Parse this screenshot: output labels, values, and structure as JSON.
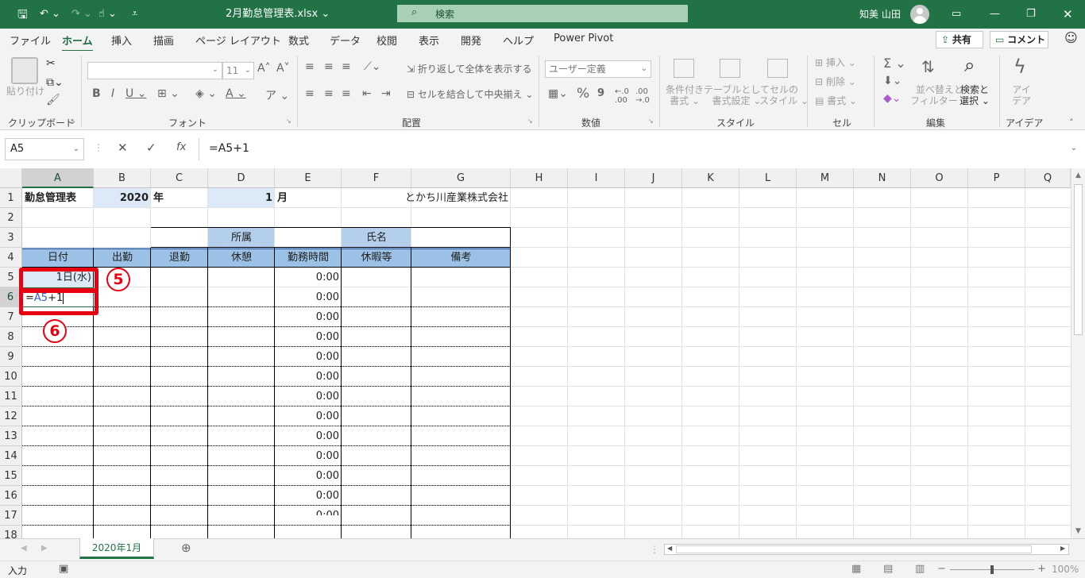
{
  "titlebar": {
    "autosave_icon": "save-icon",
    "filename": "2月勤怠管理表.xlsx",
    "search_placeholder": "検索",
    "user_name": "知美 山田",
    "bg_color": "#217346"
  },
  "menu": {
    "items": [
      "ファイル",
      "ホーム",
      "挿入",
      "描画",
      "ページ レイアウト",
      "数式",
      "データ",
      "校閲",
      "表示",
      "開発",
      "ヘルプ",
      "Power Pivot"
    ],
    "active": "ホーム",
    "share_label": "共有",
    "comment_label": "コメント"
  },
  "ribbon": {
    "paste_label": "貼り付け",
    "clipboard_group": "クリップボード",
    "font_group": "フォント",
    "font_size": "11",
    "align_group": "配置",
    "wrap_text": "折り返して全体を表示する",
    "merge_center": "セルを結合して中央揃え",
    "number_group": "数値",
    "number_format": "ユーザー定義",
    "styles_group": "スタイル",
    "cond_format_1": "条件付き",
    "cond_format_2": "書式",
    "format_table_1": "テーブルとして",
    "format_table_2": "書式設定",
    "cell_styles_1": "セルの",
    "cell_styles_2": "スタイル",
    "cells_group": "セル",
    "insert_label": "挿入",
    "delete_label": "削除",
    "format_label": "書式",
    "edit_group": "編集",
    "sort_1": "並べ替えと",
    "sort_2": "フィルター",
    "find_1": "検索と",
    "find_2": "選択",
    "ideas_group": "アイデア",
    "ideas_1": "アイ",
    "ideas_2": "デア"
  },
  "formula_bar": {
    "name_box": "A5",
    "formula": "=A5+1"
  },
  "columns": [
    "A",
    "B",
    "C",
    "D",
    "E",
    "F",
    "G",
    "H",
    "I",
    "J",
    "K",
    "L",
    "M",
    "N",
    "O",
    "P",
    "Q"
  ],
  "rows": [
    "1",
    "2",
    "3",
    "4",
    "5",
    "6",
    "7",
    "8",
    "9",
    "10",
    "11",
    "12",
    "13",
    "14",
    "15",
    "16",
    "17",
    "18"
  ],
  "cells": {
    "A1": "勤怠管理表",
    "B1": "2020",
    "C1": "年",
    "D1": "1",
    "E1": "月",
    "F1": "とかち川産業株式会社",
    "D3": "所属",
    "F3": "氏名",
    "A4": "日付",
    "B4": "出勤",
    "C4": "退勤",
    "D4": "休憩",
    "E4": "勤務時間",
    "F4": "休暇等",
    "G4": "備考",
    "A5": "1日(水)",
    "A6_prefix": "=",
    "A6_ref": "A5",
    "A6_suffix": "+1",
    "E_time": "0:00"
  },
  "annotations": {
    "step5": "5",
    "step6": "6",
    "color": "#e60012"
  },
  "sheet_tab": "2020年1月",
  "status": {
    "mode": "入力",
    "zoom": "100%"
  }
}
